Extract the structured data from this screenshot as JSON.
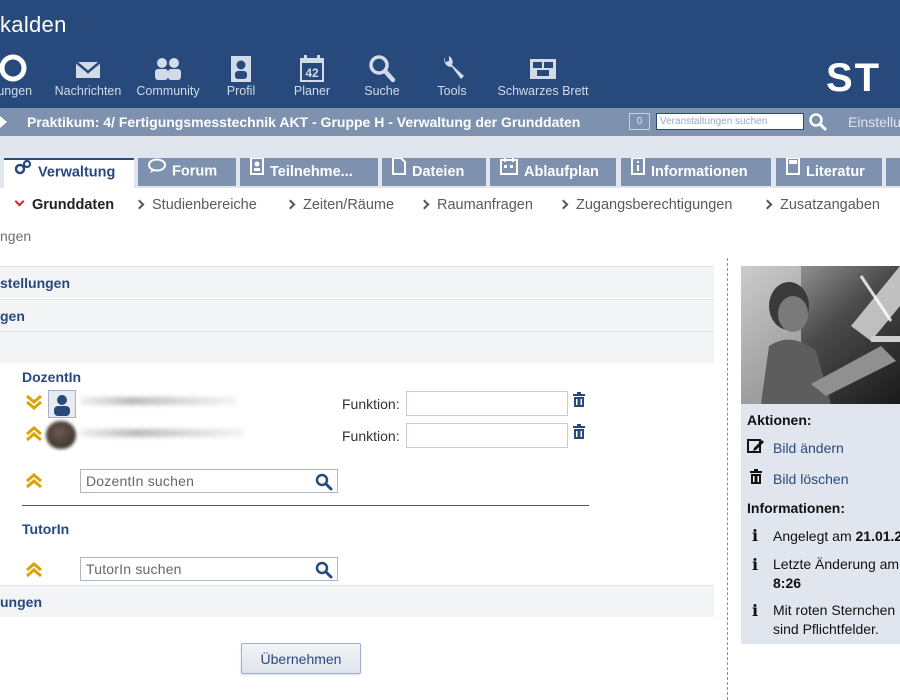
{
  "header": {
    "site_title": "kalden",
    "logo": "ST",
    "nav": [
      {
        "label": "tungen",
        "icon": "seminar-icon"
      },
      {
        "label": "Nachrichten",
        "icon": "mail-icon"
      },
      {
        "label": "Community",
        "icon": "community-icon"
      },
      {
        "label": "Profil",
        "icon": "profile-icon"
      },
      {
        "label": "Planer",
        "icon": "calendar-icon",
        "badge": "42"
      },
      {
        "label": "Suche",
        "icon": "search-icon"
      },
      {
        "label": "Tools",
        "icon": "wrench-icon"
      },
      {
        "label": "Schwarzes Brett",
        "icon": "board-icon"
      }
    ]
  },
  "context": {
    "title": "Praktikum: 4/ Fertigungsmesstechnik AKT - Gruppe H - Verwaltung der Grunddaten",
    "count": "0",
    "search_placeholder": "Veranstaltungen suchen",
    "settings": "Einstellu"
  },
  "tabs": [
    {
      "label": "Verwaltung",
      "icon": "admin-icon",
      "active": true
    },
    {
      "label": "Forum",
      "icon": "forum-icon"
    },
    {
      "label": "Teilnehme...",
      "icon": "participants-icon"
    },
    {
      "label": "Dateien",
      "icon": "files-icon"
    },
    {
      "label": "Ablaufplan",
      "icon": "schedule-icon"
    },
    {
      "label": "Informationen",
      "icon": "info-icon"
    },
    {
      "label": "Literatur",
      "icon": "literature-icon"
    }
  ],
  "subnav": [
    {
      "label": "Grunddaten",
      "active": true
    },
    {
      "label": "Studienbereiche"
    },
    {
      "label": "Zeiten/Räume"
    },
    {
      "label": "Raumanfragen"
    },
    {
      "label": "Zugangsberechtigungen"
    },
    {
      "label": "Zusatzangaben"
    }
  ],
  "breadcrumb": "ngen",
  "sections": {
    "s1": "stellungen",
    "s2": "gen",
    "s3": "",
    "s4": "ungen"
  },
  "dozent": {
    "title": "DozentIn",
    "function_label": "Funktion:",
    "search_placeholder": "DozentIn suchen"
  },
  "tutor": {
    "title": "TutorIn",
    "search_placeholder": "TutorIn suchen"
  },
  "submit_label": "Übernehmen",
  "sidebar": {
    "actions_title": "Aktionen:",
    "change_image": "Bild ändern",
    "delete_image": "Bild löschen",
    "info_title": "Informationen:",
    "created_label": "Angelegt am ",
    "created_value": "21.01.2",
    "changed_label": "Letzte Änderung am",
    "changed_value": "8:26",
    "required_line1": "Mit roten Sternchen",
    "required_line2": "sind Pflichtfelder."
  },
  "colors": {
    "primary": "#28497c",
    "secondary": "#7e92b0",
    "light": "#e1e6ee",
    "chevron_gold": "#d9a300",
    "active_red": "#d1202e"
  }
}
